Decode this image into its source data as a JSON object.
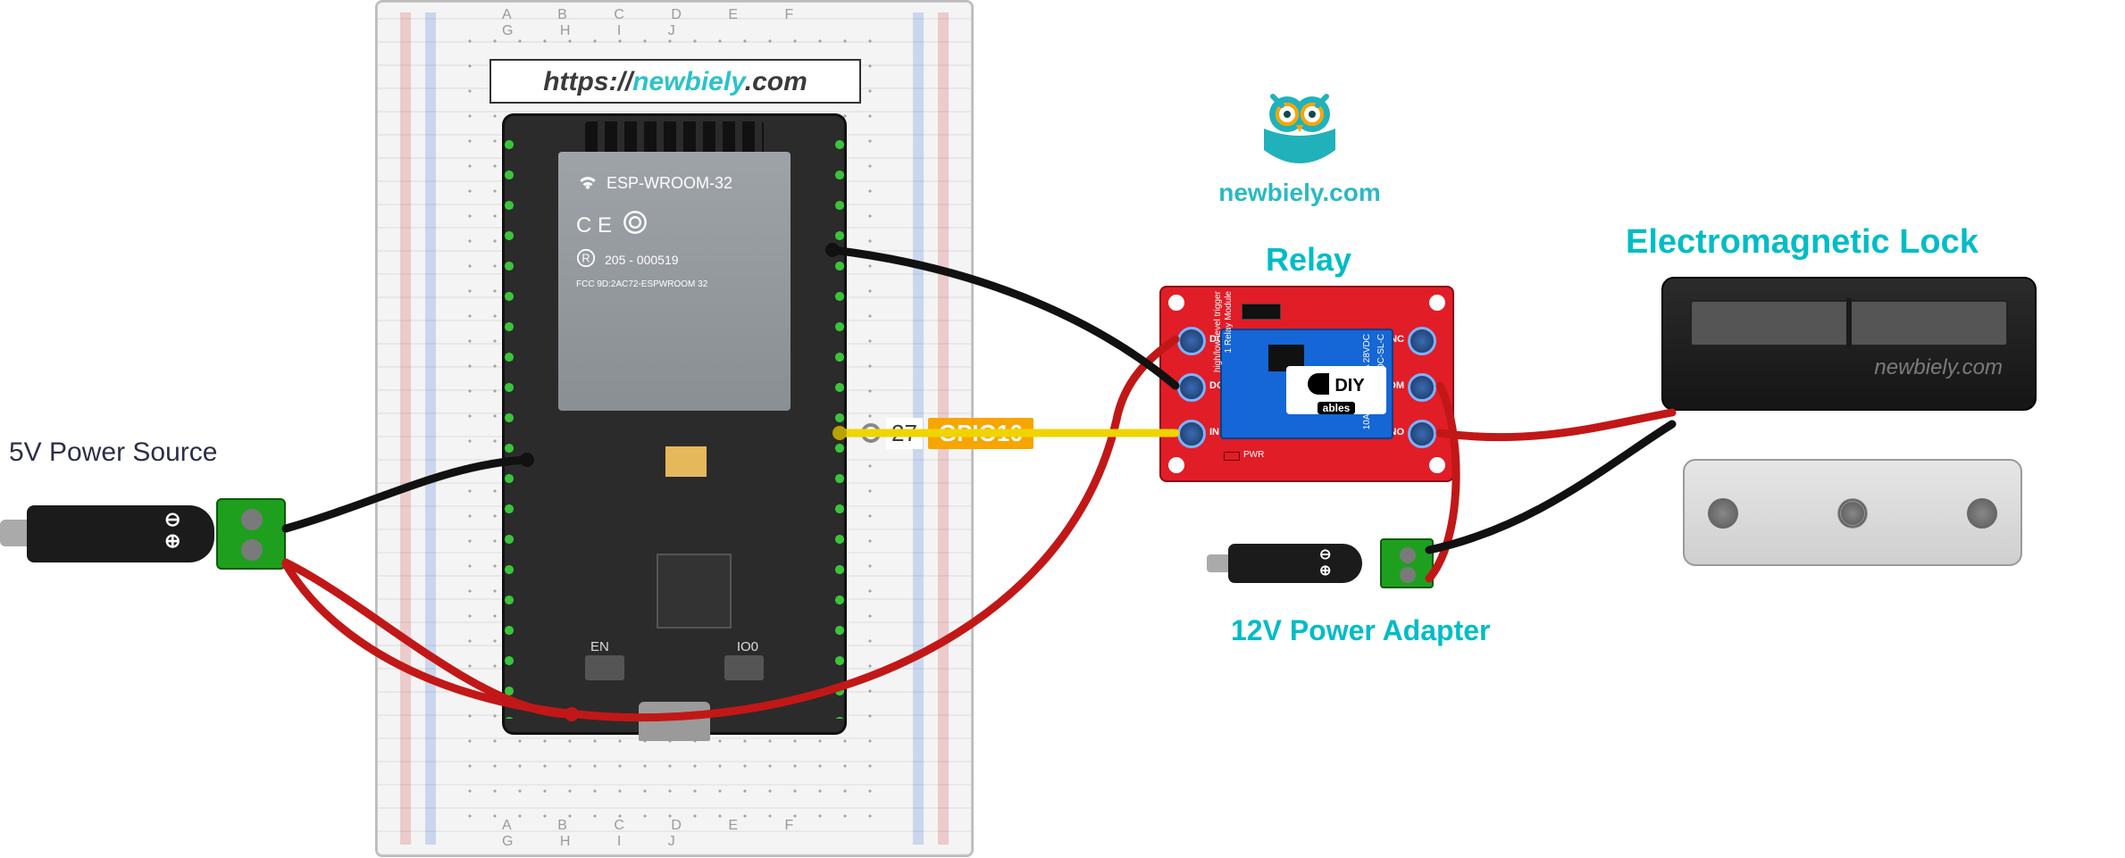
{
  "url_badge": {
    "p1": "https://",
    "p2": "newbiely",
    "p3": ".com"
  },
  "brand": {
    "owl_text": "newbiely.com"
  },
  "labels": {
    "relay": "Relay",
    "lock": "Electromagnetic Lock",
    "adapter12": "12V Power Adapter",
    "source5": "5V Power Source",
    "watermark": "newbiely.com"
  },
  "pin_callout": {
    "physical": "27",
    "gpio": "GPIO16"
  },
  "esp32": {
    "module": "ESP-WROOM-32",
    "cert": "C E",
    "fcc": "FCC  9D:2AC72-ESPWROOM 32",
    "cert_code": "205 - 000519",
    "btn_en": "EN",
    "btn_io0": "IO0"
  },
  "breadboard": {
    "cols_top": "A B C D E   F G H I J",
    "cols_bot": "A B C D E   F G H I J"
  },
  "relay": {
    "left_terminals": [
      "DC+",
      "DC-",
      "IN"
    ],
    "right_terminals": [
      "NC",
      "COM",
      "NO"
    ],
    "diy_top": "DIY",
    "diy_bottom": "ables",
    "pcb_text1": "1 Relay Module",
    "pcb_text2": "high/low level trigger",
    "relay_body": "SRD-05VDC-SL-C",
    "relay_body2": "10A 30VDC 10A 28VDC",
    "pwr": "PWR"
  },
  "plug5": {
    "plus": "⊕",
    "minus": "⊖"
  },
  "plug12": {
    "plus": "⊕",
    "minus": "⊖"
  },
  "icons": {
    "wifi": "wifi-icon",
    "rohs": "rohs-icon",
    "owl": "owl-icon"
  },
  "chart_data": {
    "type": "wiring-diagram",
    "components": [
      {
        "name": "ESP32 DevKit (ESP-WROOM-32)",
        "mount": "breadboard"
      },
      {
        "name": "Breadboard"
      },
      {
        "name": "5V Power Source (DC barrel to screw terminal)"
      },
      {
        "name": "1-Channel Relay Module (SRD-05VDC-SL-C, high/low level trigger)"
      },
      {
        "name": "12V Power Adapter (DC barrel to screw terminal)"
      },
      {
        "name": "Electromagnetic Lock (magnet + armature plate)"
      }
    ],
    "connections": [
      {
        "from": "5V Power Source +",
        "to": "ESP32 5V / VIN",
        "color": "red"
      },
      {
        "from": "5V Power Source -",
        "to": "ESP32 GND",
        "color": "black"
      },
      {
        "from": "ESP32 5V / VIN",
        "to": "Relay DC+",
        "color": "red"
      },
      {
        "from": "ESP32 GND",
        "to": "Relay DC-",
        "color": "black"
      },
      {
        "from": "ESP32 GPIO16 (pin 27)",
        "to": "Relay IN",
        "color": "yellow"
      },
      {
        "from": "12V Adapter +",
        "to": "Relay COM",
        "color": "red"
      },
      {
        "from": "Relay NO",
        "to": "Electromagnetic Lock +",
        "color": "red"
      },
      {
        "from": "12V Adapter -",
        "to": "Electromagnetic Lock -",
        "color": "black"
      }
    ],
    "callout_pin": {
      "physical_number": 27,
      "gpio": "GPIO16"
    }
  }
}
